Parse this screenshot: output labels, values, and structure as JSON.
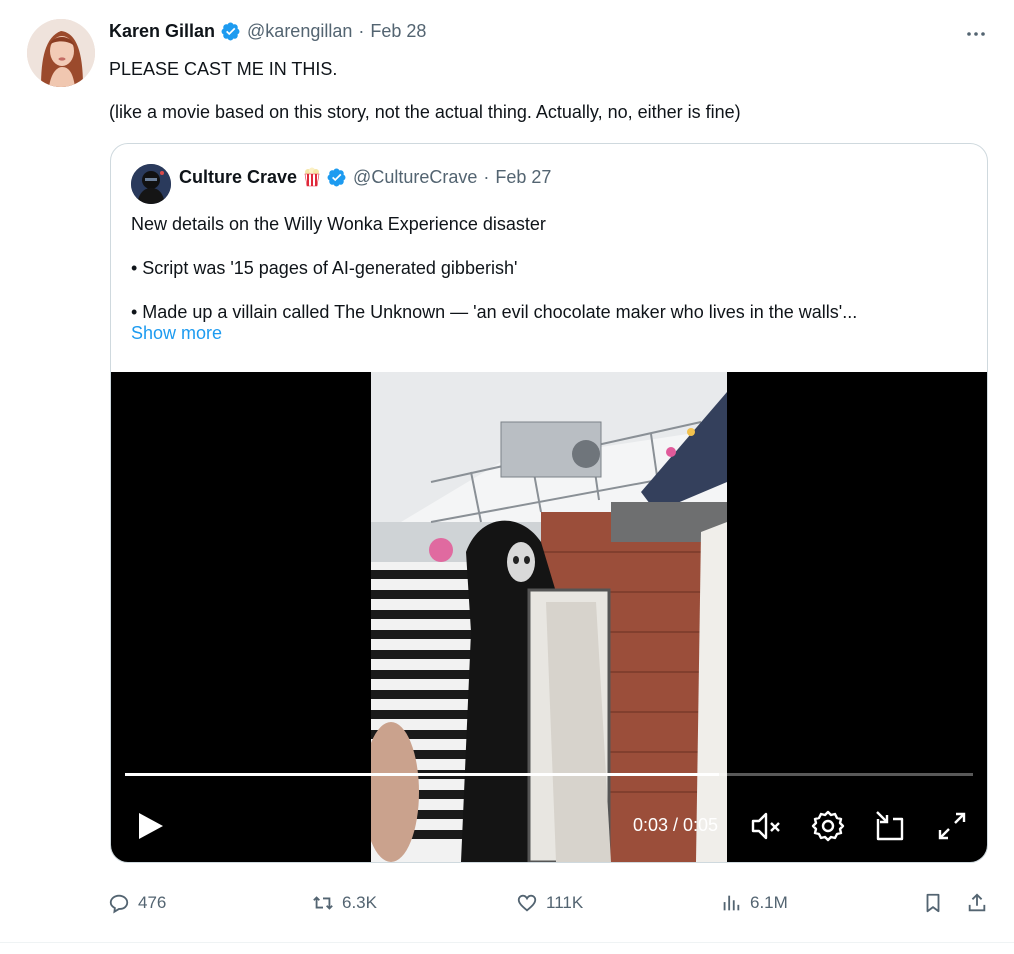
{
  "tweet": {
    "author_name": "Karen Gillan",
    "handle": "@karengillan",
    "separator": "·",
    "date": "Feb 28",
    "text_line1": "PLEASE CAST ME IN THIS.",
    "text_line2": "(like a movie based on this story, not the actual thing. Actually, no, either is fine)",
    "more_icon": "more-horizontal-icon"
  },
  "quote": {
    "author_name": "Culture Crave",
    "name_emoji": "popcorn-icon",
    "handle": "@CultureCrave",
    "separator": "·",
    "date": "Feb 27",
    "line1": "New details on the Willy Wonka Experience disaster",
    "line2": "• Script was '15 pages of AI-generated gibberish'",
    "line3": "• Made up a villain called The Unknown — 'an evil chocolate maker who lives in the walls'...",
    "show_more": "Show more"
  },
  "video": {
    "time_display": "0:03 / 0:05",
    "progress": 0.7,
    "muted": true
  },
  "actions": {
    "replies": "476",
    "reposts": "6.3K",
    "likes": "111K",
    "views": "6.1M"
  },
  "colors": {
    "accent": "#1d9bf0",
    "secondary_text": "#536471",
    "border": "#cfd9de"
  }
}
